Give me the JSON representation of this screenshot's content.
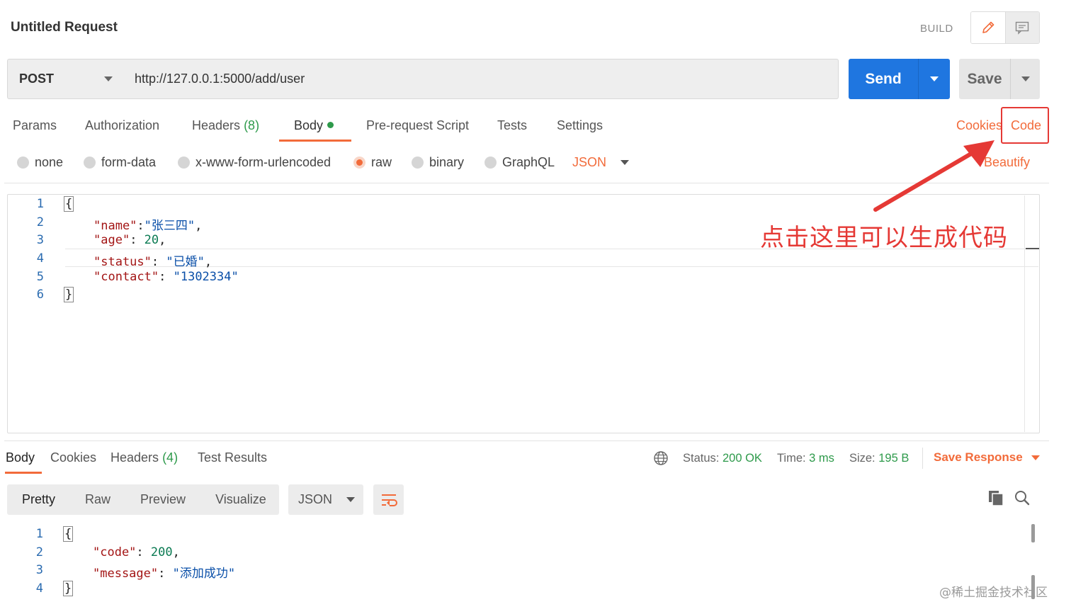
{
  "header": {
    "title": "Untitled Request",
    "build_label": "BUILD"
  },
  "request": {
    "method": "POST",
    "url": "http://127.0.0.1:5000/add/user",
    "send_label": "Send",
    "save_label": "Save"
  },
  "tabs": {
    "params": "Params",
    "authorization": "Authorization",
    "headers": "Headers",
    "headers_count": "(8)",
    "body": "Body",
    "prerequest": "Pre-request Script",
    "tests": "Tests",
    "settings": "Settings",
    "cookies": "Cookies",
    "code": "Code"
  },
  "body_types": {
    "none": "none",
    "form_data": "form-data",
    "urlencoded": "x-www-form-urlencoded",
    "raw": "raw",
    "binary": "binary",
    "graphql": "GraphQL",
    "format": "JSON",
    "beautify": "Beautify",
    "selected": "raw"
  },
  "request_body": {
    "line_numbers": [
      "1",
      "2",
      "3",
      "4",
      "5",
      "6"
    ],
    "open_brace": "{",
    "close_brace": "}",
    "name_key": "\"name\"",
    "name_value": "\"张三四\"",
    "age_key": "\"age\"",
    "age_value": "20",
    "status_key": "\"status\"",
    "status_value": "\"已婚\"",
    "contact_key": "\"contact\"",
    "contact_value": "\"1302334\""
  },
  "annotation": {
    "text": "点击这里可以生成代码",
    "color": "#e53935"
  },
  "response": {
    "tabs": {
      "body": "Body",
      "cookies": "Cookies",
      "headers": "Headers",
      "headers_count": "(4)",
      "test_results": "Test Results"
    },
    "status_label": "Status:",
    "status_value": "200 OK",
    "time_label": "Time:",
    "time_value": "3 ms",
    "size_label": "Size:",
    "size_value": "195 B",
    "save_response": "Save Response",
    "views": {
      "pretty": "Pretty",
      "raw": "Raw",
      "preview": "Preview",
      "visualize": "Visualize"
    },
    "format": "JSON",
    "body": {
      "line_numbers": [
        "1",
        "2",
        "3",
        "4"
      ],
      "open_brace": "{",
      "close_brace": "}",
      "code_key": "\"code\"",
      "code_value": "200",
      "message_key": "\"message\"",
      "message_value": "\"添加成功\""
    }
  },
  "watermark": "@稀土掘金技术社区",
  "colors": {
    "accent": "#f26b3a",
    "send": "#1f76e0",
    "success": "#2e9a4b"
  },
  "icons": {
    "edit": "pencil-icon",
    "comments": "comment-icon",
    "globe": "globe-icon",
    "copy": "copy-icon",
    "search": "search-icon",
    "wrap": "wrap-lines-icon"
  }
}
